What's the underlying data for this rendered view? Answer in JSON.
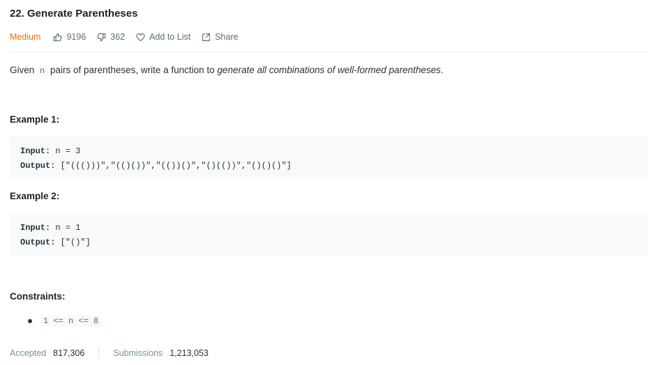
{
  "problem": {
    "title": "22. Generate Parentheses",
    "difficulty": "Medium",
    "likes": "9196",
    "dislikes": "362",
    "add_to_list_label": "Add to List",
    "share_label": "Share"
  },
  "description": {
    "prefix": "Given",
    "variable": "n",
    "middle": "pairs of parentheses, write a function to",
    "emphasis": "generate all combinations of well-formed parentheses",
    "suffix": "."
  },
  "examples": [
    {
      "heading": "Example 1:",
      "input_label": "Input:",
      "input_value": "n = 3",
      "output_label": "Output:",
      "output_value": "[\"((()))\",\"(()())\",\"(())()\",\"()(())\",\"()()()\"]"
    },
    {
      "heading": "Example 2:",
      "input_label": "Input:",
      "input_value": "n = 1",
      "output_label": "Output:",
      "output_value": "[\"()\"]"
    }
  ],
  "constraints": {
    "heading": "Constraints:",
    "items": [
      "1 <= n <= 8"
    ]
  },
  "stats": {
    "accepted_label": "Accepted",
    "accepted_value": "817,306",
    "submissions_label": "Submissions",
    "submissions_value": "1,213,053"
  },
  "colors": {
    "difficulty": "#ef6c00",
    "text": "#263238",
    "muted": "#546e7a",
    "code_bg": "#f7f9fa"
  },
  "icons": [
    "thumbs-up-icon",
    "thumbs-down-icon",
    "heart-icon",
    "share-icon"
  ]
}
